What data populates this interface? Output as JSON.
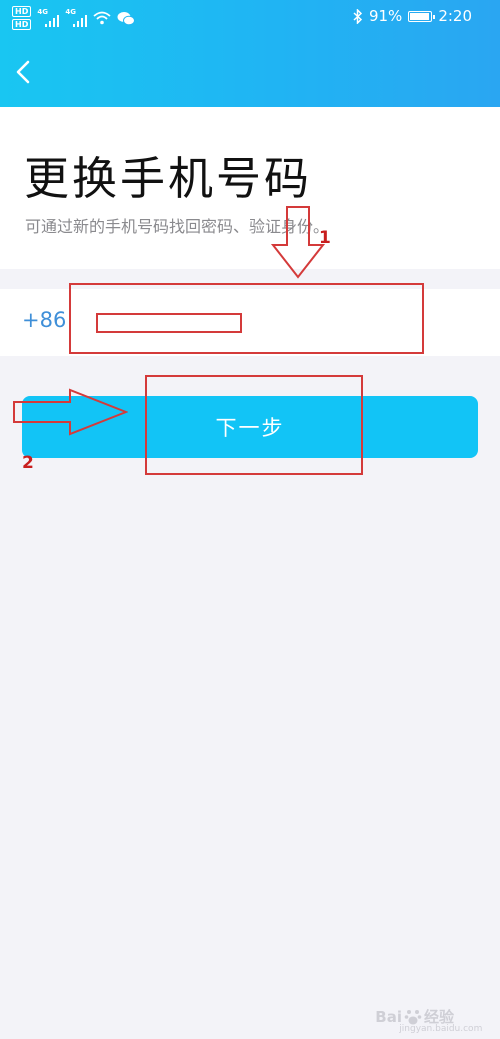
{
  "status_bar": {
    "hd_labels": [
      "HD",
      "HD"
    ],
    "network_labels": [
      "4G",
      "4G"
    ],
    "battery_percent": "91%",
    "battery_level": 0.91,
    "time": "2:20",
    "icons": [
      "signal-icon",
      "wifi-icon",
      "wechat-icon",
      "bluetooth-icon",
      "battery-icon"
    ]
  },
  "header": {
    "back_icon": "chevron-left-icon"
  },
  "page": {
    "title": "更换手机号码",
    "subtitle": "可通过新的手机号码找回密码、验证身份。"
  },
  "phone": {
    "country_code": "+86",
    "value": "",
    "placeholder": ""
  },
  "next_button": {
    "label": "下一步"
  },
  "annotations": {
    "num1": "1",
    "num2": "2"
  },
  "watermark": {
    "brand": "Bai",
    "brand_suffix": "经验",
    "url": "jingyan.baidu.com"
  },
  "colors": {
    "header_gradient_start": "#19c6f2",
    "header_gradient_end": "#2aa6f2",
    "button": "#12c4f6",
    "country_code": "#3f8fd8",
    "annotation": "#d43a3a"
  }
}
